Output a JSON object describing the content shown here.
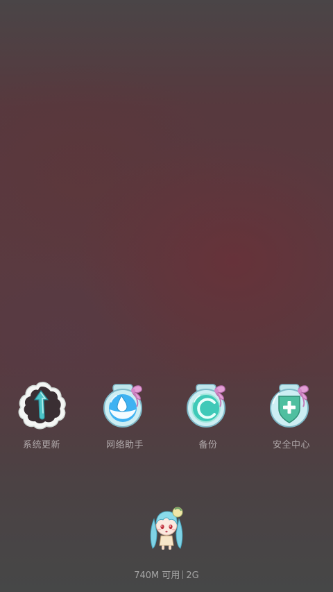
{
  "apps": [
    {
      "label": "系统更新",
      "icon": "system-update-icon"
    },
    {
      "label": "网络助手",
      "icon": "network-assistant-icon"
    },
    {
      "label": "备份",
      "icon": "backup-icon"
    },
    {
      "label": "安全中心",
      "icon": "security-center-icon"
    }
  ],
  "memory": {
    "available": "740M 可用",
    "total": "2G"
  },
  "mascot": {
    "icon": "anime-girl-mascot-icon"
  },
  "colors": {
    "jar_glass": "#bfe6ec",
    "water_blue": "#3fb2f2",
    "water_teal": "#3fc9b8",
    "ribbon_pink": "#e39fd6",
    "shield_green": "#4fbfa0"
  }
}
